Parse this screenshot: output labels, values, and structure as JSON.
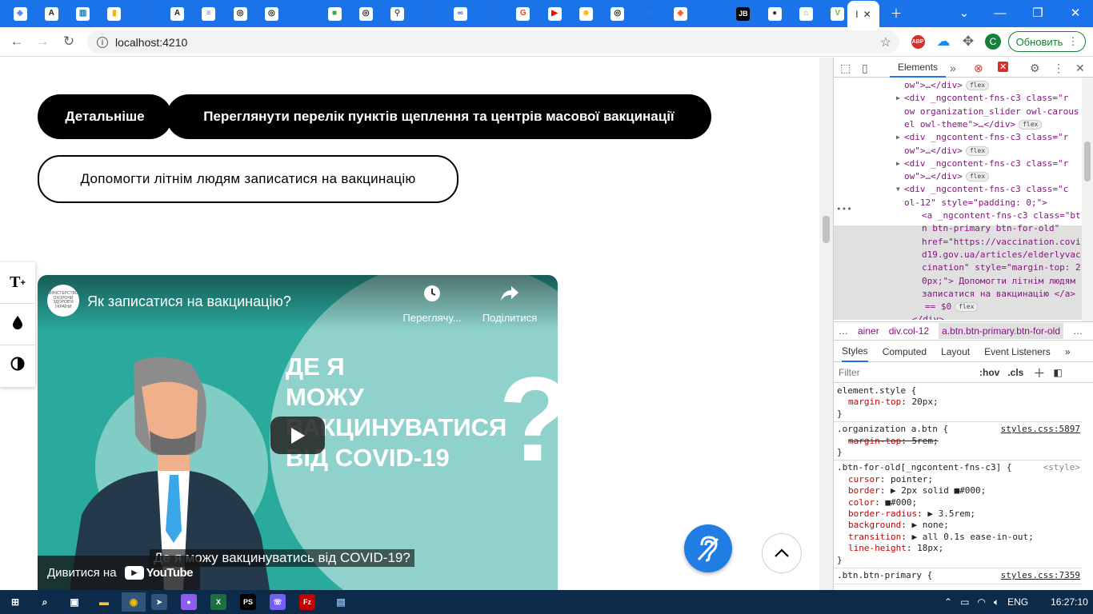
{
  "browser": {
    "tabs": [
      {
        "icon": "cube-icon",
        "color": "#5c8df6"
      },
      {
        "icon": "angular-icon",
        "color": "#222"
      },
      {
        "icon": "trello-icon",
        "color": "#0079bf"
      },
      {
        "icon": "chart-icon",
        "color": "#f4b400"
      },
      {
        "icon": "spinner-icon",
        "color": "#888"
      },
      {
        "icon": "angular-icon",
        "color": "#222"
      },
      {
        "icon": "docs-icon",
        "color": "#4285f4"
      },
      {
        "icon": "github-icon",
        "color": "#222"
      },
      {
        "icon": "github-icon",
        "color": "#222"
      },
      {
        "icon": "blank-icon",
        "color": "#1a73e8"
      },
      {
        "icon": "colorful-icon",
        "color": "#34a853"
      },
      {
        "icon": "github-icon",
        "color": "#222"
      },
      {
        "icon": "bulb-icon",
        "color": "#555"
      },
      {
        "icon": "spinner-icon",
        "color": "#888"
      },
      {
        "icon": "meta-icon",
        "color": "#0866ff"
      },
      {
        "icon": "spinner-icon",
        "color": "#888"
      },
      {
        "icon": "google-icon",
        "color": "#ea4335"
      },
      {
        "icon": "youtube-icon",
        "color": "#ff0000"
      },
      {
        "icon": "emoji-icon",
        "color": "#f9ab00"
      },
      {
        "icon": "github-icon",
        "color": "#222"
      },
      {
        "icon": "spinner-icon",
        "color": "#888"
      },
      {
        "icon": "brave-icon",
        "color": "#fb542b"
      },
      {
        "icon": "blank-icon",
        "color": "#1a73e8"
      },
      {
        "icon": "jetbrains-icon",
        "color": "#000"
      },
      {
        "icon": "circle-icon",
        "color": "#333"
      },
      {
        "icon": "hat-icon",
        "color": "#888"
      },
      {
        "icon": "v-icon",
        "color": "#7cb342"
      }
    ],
    "active_tab_label": "I",
    "jb_label": "JB",
    "url": "localhost:4210",
    "update_button": "Обновить",
    "profile_initial": "C",
    "ext_badge": "ABP",
    "ext_count": "1"
  },
  "page": {
    "btn_details": "Детальніше",
    "btn_list": "Переглянути перелік пунктів щеплення та центрів масової вакцинації",
    "btn_elderly": "Допомогти літнім людям записатися на вакцинацію",
    "a11y": {
      "text_size": "T",
      "text_size_sup": "+",
      "saturation_icon": "drop-icon",
      "contrast_icon": "contrast-icon"
    },
    "video": {
      "title": "Як записатися на вакцинацію?",
      "channel_logo_text": "МІНІСТЕРСТВО ОХОРОНИ ЗДОРОВ'Я УКРАЇНИ",
      "watch_later": "Переглячу...",
      "share": "Поділитися",
      "headline_lines": [
        "ДЕ Я",
        "МОЖУ",
        "ВАКЦИНУВАТИСЯ",
        "ВІД COVID-19"
      ],
      "subtitle": "Де я можу вакцинуватись  від COVID-19?",
      "watch_on": "Дивитися на",
      "youtube": "YouTube",
      "bg_color": "#2aa99d"
    }
  },
  "devtools": {
    "panel_tab": "Elements",
    "dom_lines": [
      {
        "indent": 88,
        "html": "ow\">…</div>",
        "badge": "flex"
      },
      {
        "indent": 88,
        "tri": "▶",
        "html": "<div _ngcontent-fns-c3 class=\"r"
      },
      {
        "indent": 88,
        "html": "ow organization_slider owl-carous"
      },
      {
        "indent": 88,
        "html": "el owl-theme\">…</div>",
        "badge": "flex"
      },
      {
        "indent": 88,
        "tri": "▶",
        "html": "<div _ngcontent-fns-c3 class=\"r"
      },
      {
        "indent": 88,
        "html": "ow\">…</div>",
        "badge": "flex"
      },
      {
        "indent": 88,
        "tri": "▶",
        "html": "<div _ngcontent-fns-c3 class=\"r"
      },
      {
        "indent": 88,
        "html": "ow\">…</div>",
        "badge": "flex"
      },
      {
        "indent": 88,
        "tri": "▼",
        "html": "<div _ngcontent-fns-c3 class=\"c"
      },
      {
        "indent": 88,
        "html": "ol-12\" style=\"padding: 0;\">"
      },
      {
        "indent": 110,
        "html": "<a _ngcontent-fns-c3 class=\"bt"
      },
      {
        "indent": 110,
        "html": "n btn-primary btn-for-old\""
      },
      {
        "indent": 110,
        "html": "href=\"https://vaccination.covi"
      },
      {
        "indent": 110,
        "html": "d19.gov.ua/articles/elderlyvac"
      },
      {
        "indent": 110,
        "html": "cination\" style=\"margin-top: 2"
      },
      {
        "indent": 110,
        "html": "0px;\"> Допомогти літнім людям"
      },
      {
        "indent": 110,
        "html": "записатися на вакцинацію </a>"
      },
      {
        "indent": 114,
        "html": "== $0",
        "badge": "flex"
      },
      {
        "indent": 98,
        "html": "</div>"
      }
    ],
    "breadcrumb": [
      "…",
      "ainer",
      "div.col-12",
      "a.btn.btn-primary.btn-for-old",
      "…"
    ],
    "styles_tabs": [
      "Styles",
      "Computed",
      "Layout",
      "Event Listeners"
    ],
    "filter_placeholder": "Filter",
    "hov": ":hov",
    "cls": ".cls",
    "rules": [
      {
        "selector": "element.style {",
        "source": "",
        "props": [
          {
            "name": "margin-top",
            "value": "20px;"
          }
        ]
      },
      {
        "selector": ".organization a.btn {",
        "source": "styles.css:5897",
        "props": [
          {
            "name": "margin-top",
            "value": "5rem;",
            "struck": true
          }
        ]
      },
      {
        "selector": ".btn-for-old[_ngcontent-fns-c3] {",
        "source": "<style>",
        "props": [
          {
            "name": "cursor",
            "value": "pointer;"
          },
          {
            "name": "border",
            "value": "▶ 2px solid ■#000;"
          },
          {
            "name": "color",
            "value": "■#000;"
          },
          {
            "name": "border-radius",
            "value": "▶ 3.5rem;"
          },
          {
            "name": "background",
            "value": "▶ none;"
          },
          {
            "name": "transition",
            "value": "▶ all 0.1s ease-in-out;"
          },
          {
            "name": "line-height",
            "value": "18px;"
          }
        ]
      },
      {
        "selector": ".btn.btn-primary {",
        "source": "styles.css:7359",
        "props": []
      }
    ]
  },
  "taskbar": {
    "apps": [
      "windows-icon",
      "search-icon",
      "taskview-icon",
      "explorer-icon",
      "chrome-icon",
      "telegram-icon",
      "github-desktop-icon",
      "excel-icon",
      "phpstorm-icon",
      "viber-icon",
      "filezilla-icon",
      "notepad-icon"
    ],
    "lang": "ENG",
    "time": "16:27:10"
  }
}
